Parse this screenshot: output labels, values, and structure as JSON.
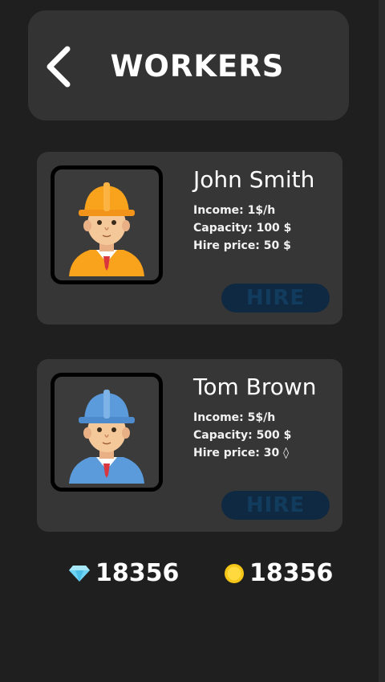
{
  "header": {
    "title": "WORKERS",
    "back_icon": "chevron-left-icon"
  },
  "workers": [
    {
      "name": "John Smith",
      "income": "Income: 1$/h",
      "capacity": "Capacity: 100 $",
      "hire_price": "Hire price: 50 $",
      "hire_label": "HIRE",
      "avatar": "worker-orange-helmet-icon",
      "helmet_color": "#f9a21c"
    },
    {
      "name": "Tom Brown",
      "income": "Income: 5$/h",
      "capacity": "Capacity: 500 $",
      "hire_price": "Hire price: 30 ◊",
      "hire_label": "HIRE",
      "avatar": "worker-blue-helmet-icon",
      "helmet_color": "#5b9bdc"
    }
  ],
  "currency": {
    "gems": {
      "icon": "diamond-icon",
      "amount": "18356"
    },
    "coins": {
      "icon": "coin-icon",
      "amount": "18356"
    }
  },
  "colors": {
    "background": "#1f1f1f",
    "panel": "#363636",
    "hire_button": "#0f2942",
    "hire_text": "#123c5e"
  }
}
